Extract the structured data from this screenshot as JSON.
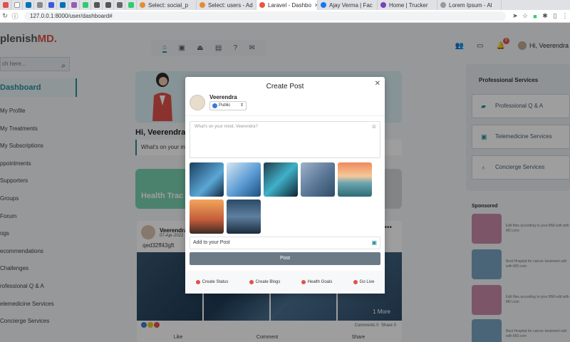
{
  "browser": {
    "tabs": [
      {
        "label": "Select: social_p",
        "favicon_color": "#e88b2e"
      },
      {
        "label": "Select: users - Ad",
        "favicon_color": "#e88b2e"
      },
      {
        "label": "Laravel - Dashbo",
        "favicon_color": "#f05340",
        "active": true
      },
      {
        "label": "Ajay Verma | Fac",
        "favicon_color": "#1877f2"
      },
      {
        "label": "Home | Trucker",
        "favicon_color": "#7b3fbf"
      },
      {
        "label": "Lorem Ipsum - Al",
        "favicon_color": "#999999"
      }
    ],
    "url": "127.0.0.1:8000/user/dashboard#"
  },
  "logo": {
    "prefix": "plenish",
    "suffix": "MD."
  },
  "sidebar": {
    "search_placeholder": "ch here...",
    "active": "Dashboard",
    "items": [
      "My Profile",
      "My Treatments",
      "My Subscriptions",
      "ppointments",
      "Supporters",
      "Groups",
      "Forum",
      "ogs",
      "ecommendations",
      "Challenges",
      "rofessional Q & A",
      "elemedicine Services",
      "Concierge Services"
    ]
  },
  "header": {
    "user_name": "Hi, Veerendra",
    "notification_count": "0"
  },
  "main": {
    "greeting": "Hi, Veerendra",
    "whats_on_mind": "What's on your mi",
    "health_card": "Health Trac"
  },
  "feed": {
    "author": "Veerendra",
    "date": "07-Apr-2022",
    "text": "qed32ff43gft",
    "more_photos": "1 More",
    "comments": "Comments 0",
    "shares": "Share 0",
    "actions": [
      "Like",
      "Comment",
      "Share"
    ]
  },
  "right_panel": {
    "title": "Professional Services",
    "buttons": [
      "Professional Q & A",
      "Telemedicine Services",
      "Concierge Services"
    ]
  },
  "sponsored": {
    "title": "Sponsored",
    "items": [
      {
        "text": "Edit files according to your BMI edit with MD.com",
        "color": "#c98aa8"
      },
      {
        "text": "Best Hospital for cancer treatment edit with MD.com",
        "color": "#7aa3c2"
      },
      {
        "text": "Edit files according to your BMI edit with MD.com",
        "color": "#c98aa8"
      },
      {
        "text": "Best Hospital for cancer treatment edit with MD.com",
        "color": "#7aa3c2"
      }
    ]
  },
  "modal": {
    "title": "Create Post",
    "user": "Veerendra",
    "privacy": "Public",
    "placeholder": "What's on your mind, Veerendra?",
    "add_to_post": "Add to your Post",
    "post_button": "Post",
    "footer": [
      "Create Status",
      "Create Blogs",
      "Health Goals",
      "Go Live"
    ]
  }
}
